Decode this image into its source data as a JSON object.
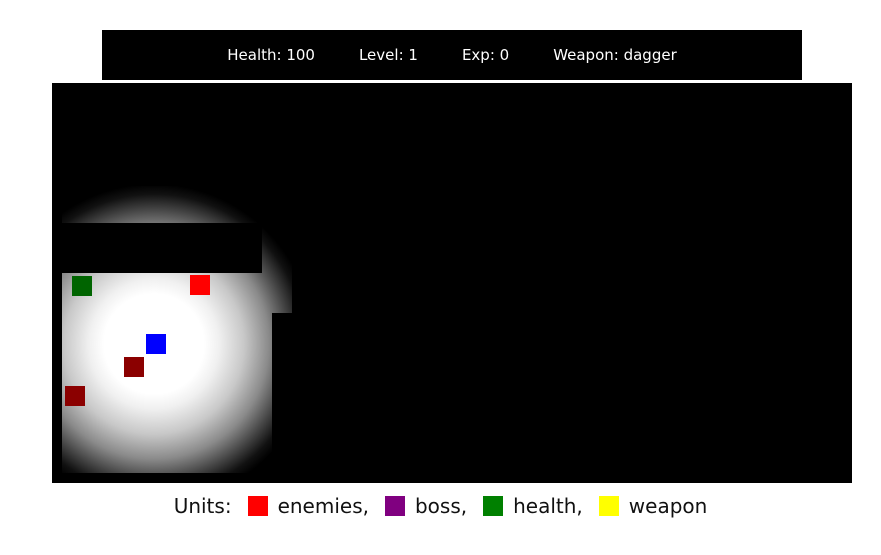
{
  "hud": {
    "health": "Health: 100",
    "level": "Level: 1",
    "exp": "Exp: 0",
    "weapon": "Weapon: dagger"
  },
  "board": {
    "background_color": "#000000",
    "light_color": "#ffffff",
    "units": [
      {
        "kind": "player",
        "color": "#0000ff"
      },
      {
        "kind": "enemy",
        "color": "#ff0000"
      },
      {
        "kind": "enemy",
        "color": "#8b0000"
      },
      {
        "kind": "enemy",
        "color": "#8b0000"
      },
      {
        "kind": "health",
        "color": "#006400"
      }
    ]
  },
  "legend": {
    "title": "Units:",
    "entries": [
      {
        "label": "enemies,",
        "color": "#ff0000"
      },
      {
        "label": "boss,",
        "color": "#800080"
      },
      {
        "label": "health,",
        "color": "#008000"
      },
      {
        "label": "weapon",
        "color": "#ffff00"
      }
    ]
  }
}
